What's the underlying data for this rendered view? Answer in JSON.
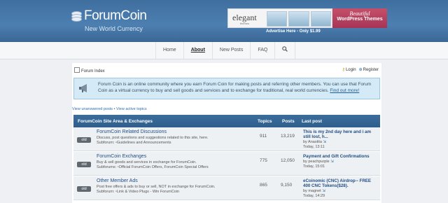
{
  "header": {
    "title": "ForumCoin",
    "tagline": "New World Currency"
  },
  "ad": {
    "brand": "elegant",
    "brand_sub": "themes",
    "banner_line1": "Beautiful",
    "banner_line2": "WordPress Themes",
    "advertise": "Advertise Here - Only $1.99"
  },
  "nav": {
    "items": [
      "Home",
      "About",
      "New Posts",
      "FAQ"
    ],
    "active": "About",
    "search_icon": "magnifier-icon"
  },
  "topbar": {
    "home": "Forum Index",
    "login": "Login",
    "register": "Register"
  },
  "info": {
    "text": "Forum Coin is an online community where you earn Forum Coin for making posts and referring other members. You can use that Forum Coin as a virtual currency to buy and sell goods and services and to exchange for traditional, real world currencies.",
    "link": "Find out more!"
  },
  "links": {
    "unanswered": "View unanswered posts",
    "sep": " • ",
    "active": "View active topics"
  },
  "table": {
    "headers": [
      "ForumCoin Site Area & Exchanges",
      "Topics",
      "Posts",
      "Last post"
    ],
    "rows": [
      {
        "status": "old",
        "title": "ForumCoin Related Discussions",
        "desc": "Discuss, post questions and suggestions related to this site, here.",
        "subforum_label": "Subforum:",
        "subforums": "Guidelines and Announcements",
        "topics": "911",
        "posts": "13,219",
        "last_title": "This is my 2nd day here and i am still lost, h...",
        "last_by": "by Anastita",
        "last_time": "Today, 13:11"
      },
      {
        "status": "old",
        "title": "ForumCoin Exchanges",
        "desc": "Buy & sell goods and services in exchange for ForumCoin.",
        "subforum_label": "Subforums:",
        "subforums": "Official ForumCoin Offers, ForumCoin Special Offers",
        "topics": "775",
        "posts": "12,050",
        "last_title": "Payment and Gift Confirmations",
        "last_by": "by peachpurple",
        "last_time": "Today, 15:01"
      },
      {
        "status": "old",
        "title": "Other Member Ads",
        "desc": "Post free offers & ads to buy or sell, NOT in exchange for ForumCoin.",
        "subforum_label": "Subforum:",
        "subforums": "Link & Video Plugs - Win ForumCoin",
        "topics": "865",
        "posts": "9,150",
        "last_title": "eCoinomic (CNC) Airdrop-- FREE 400 CNC Tokens($28).",
        "last_by": "by magnet",
        "last_time": "Today, 14:29"
      }
    ]
  }
}
